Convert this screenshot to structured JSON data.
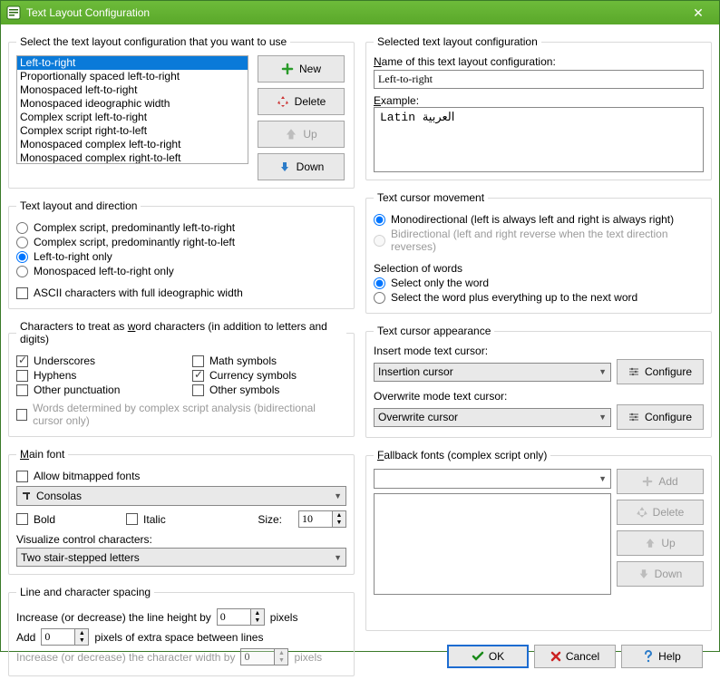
{
  "window": {
    "title": "Text Layout Configuration"
  },
  "left": {
    "select_group": {
      "legend": "Select the text layout configuration that you want to use",
      "items": [
        "Left-to-right",
        "Proportionally spaced left-to-right",
        "Monospaced left-to-right",
        "Monospaced ideographic width",
        "Complex script left-to-right",
        "Complex script right-to-left",
        "Monospaced complex left-to-right",
        "Monospaced complex right-to-left"
      ],
      "new": "New",
      "delete": "Delete",
      "up": "Up",
      "down": "Down"
    },
    "layout_group": {
      "legend": "Text layout and direction",
      "r1": "Complex script, predominantly left-to-right",
      "r2": "Complex script, predominantly right-to-left",
      "r3": "Left-to-right only",
      "r4": "Monospaced left-to-right only",
      "asc": "ASCII characters with full ideographic width"
    },
    "wordchars": {
      "legend": "Characters to treat as word characters (in addition to letters and digits)",
      "c1": "Underscores",
      "c2": "Math symbols",
      "c3": "Hyphens",
      "c4": "Currency symbols",
      "c5": "Other punctuation",
      "c6": "Other symbols",
      "note": "Words determined by complex script analysis (bidirectional cursor only)"
    },
    "mainfont": {
      "legend": "Main font",
      "allowbmp": "Allow bitmapped fonts",
      "font": "Consolas",
      "bold": "Bold",
      "italic": "Italic",
      "sizelabel": "Size:",
      "size": "10",
      "visualize": "Visualize control characters:",
      "vis_opt": "Two stair-stepped letters"
    },
    "spacing": {
      "legend": "Line and character spacing",
      "lh_pre": "Increase (or decrease) the line height by",
      "lh_val": "0",
      "lh_post": "pixels",
      "add_pre": "Add",
      "add_val": "0",
      "add_post": "pixels of extra space between lines",
      "cw_pre": "Increase (or decrease) the character width by",
      "cw_val": "0",
      "cw_post": "pixels"
    }
  },
  "right": {
    "selected": {
      "legend": "Selected text layout configuration",
      "name_lbl": "Name of this text layout configuration:",
      "name_val": "Left-to-right",
      "example_lbl": "Example:",
      "example_txt": "Latin العربية"
    },
    "cursor_move": {
      "legend": "Text cursor movement",
      "r1": "Monodirectional (left is always left and right is always right)",
      "r2": "Bidirectional (left and right reverse when the text direction reverses)",
      "sel_lbl": "Selection of words",
      "s1": "Select only the word",
      "s2": "Select the word plus everything up to the next word"
    },
    "cursor_app": {
      "legend": "Text cursor appearance",
      "ins_lbl": "Insert mode text cursor:",
      "ins_val": "Insertion cursor",
      "ovr_lbl": "Overwrite mode text cursor:",
      "ovr_val": "Overwrite cursor",
      "conf": "Configure"
    },
    "fallback": {
      "legend": "Fallback fonts (complex script only)",
      "add": "Add",
      "delete": "Delete",
      "up": "Up",
      "down": "Down"
    }
  },
  "dlg": {
    "ok": "OK",
    "cancel": "Cancel",
    "help": "Help"
  }
}
